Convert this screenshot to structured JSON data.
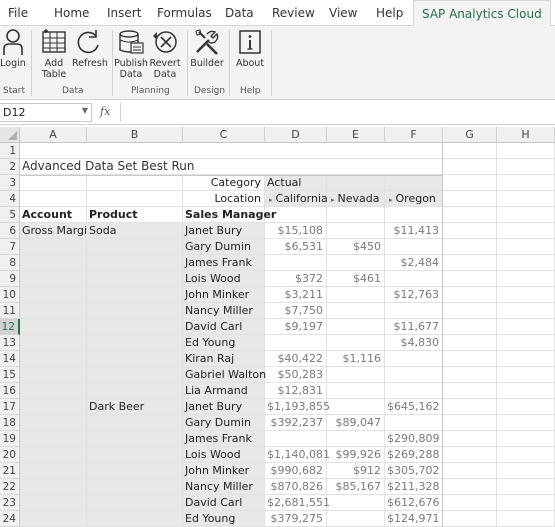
{
  "tabs": [
    "File",
    "Home",
    "Insert",
    "Formulas",
    "Data",
    "Review",
    "View",
    "Help",
    "SAP Analytics Cloud"
  ],
  "ribbon": {
    "buttons": [
      {
        "id": "login",
        "label": "Login",
        "icon": "person-icon"
      },
      {
        "id": "add-table",
        "label": "Add\nTable",
        "icon": "table-icon"
      },
      {
        "id": "refresh",
        "label": "Refresh",
        "icon": "refresh-icon"
      },
      {
        "id": "publish-data",
        "label": "Publish\nData",
        "icon": "publish-icon"
      },
      {
        "id": "revert-data",
        "label": "Revert\nData",
        "icon": "revert-icon"
      },
      {
        "id": "builder",
        "label": "Builder",
        "icon": "tools-icon"
      },
      {
        "id": "about",
        "label": "About",
        "icon": "info-icon"
      }
    ],
    "groups": [
      "Start",
      "Data",
      "Planning",
      "Design",
      "Help"
    ]
  },
  "formula_bar": {
    "name_box": "D12",
    "fx": "fx",
    "value": ""
  },
  "columns": [
    "A",
    "B",
    "C",
    "D",
    "E",
    "F",
    "G",
    "H"
  ],
  "rows": [
    "1",
    "2",
    "3",
    "4",
    "5",
    "6",
    "7",
    "8",
    "9",
    "10",
    "11",
    "12",
    "13",
    "14",
    "15",
    "16",
    "17",
    "18",
    "19",
    "20",
    "21",
    "22",
    "23",
    "24"
  ],
  "selected_row": "12",
  "sheet": {
    "title": "Advanced Data Set Best Run",
    "category_label": "Category",
    "category_value": "Actual",
    "location_label": "Location",
    "locations": [
      "California",
      "Nevada",
      "Oregon"
    ],
    "headers": {
      "account": "Account",
      "product": "Product",
      "sales_manager": "Sales Manager"
    },
    "account": "Gross Margin",
    "products": [
      "Soda",
      "Dark Beer"
    ],
    "data": [
      {
        "manager": "Janet Bury",
        "ca": "$15,108",
        "nv": "",
        "or": "$11,413"
      },
      {
        "manager": "Gary Dumin",
        "ca": "$6,531",
        "nv": "$450",
        "or": ""
      },
      {
        "manager": "James Frank",
        "ca": "",
        "nv": "",
        "or": "$2,484"
      },
      {
        "manager": "Lois Wood",
        "ca": "$372",
        "nv": "$461",
        "or": ""
      },
      {
        "manager": "John Minker",
        "ca": "$3,211",
        "nv": "",
        "or": "$12,763"
      },
      {
        "manager": "Nancy Miller",
        "ca": "$7,750",
        "nv": "",
        "or": ""
      },
      {
        "manager": "David Carl",
        "ca": "$9,197",
        "nv": "",
        "or": "$11,677"
      },
      {
        "manager": "Ed Young",
        "ca": "",
        "nv": "",
        "or": "$4,830"
      },
      {
        "manager": "Kiran Raj",
        "ca": "$40,422",
        "nv": "$1,116",
        "or": ""
      },
      {
        "manager": "Gabriel Walton",
        "ca": "$50,283",
        "nv": "",
        "or": ""
      },
      {
        "manager": "Lia Armand",
        "ca": "$12,831",
        "nv": "",
        "or": ""
      },
      {
        "manager": "Janet Bury",
        "ca": "$1,193,855",
        "nv": "",
        "or": "$645,162"
      },
      {
        "manager": "Gary Dumin",
        "ca": "$392,237",
        "nv": "$89,047",
        "or": ""
      },
      {
        "manager": "James Frank",
        "ca": "",
        "nv": "",
        "or": "$290,809"
      },
      {
        "manager": "Lois Wood",
        "ca": "$1,140,081",
        "nv": "$99,926",
        "or": "$269,288"
      },
      {
        "manager": "John Minker",
        "ca": "$990,682",
        "nv": "$912",
        "or": "$305,702"
      },
      {
        "manager": "Nancy Miller",
        "ca": "$870,826",
        "nv": "$85,167",
        "or": "$211,328"
      },
      {
        "manager": "David Carl",
        "ca": "$2,681,551",
        "nv": "",
        "or": "$612,676"
      },
      {
        "manager": "Ed Young",
        "ca": "$379,275",
        "nv": "",
        "or": "$124,971"
      }
    ]
  }
}
